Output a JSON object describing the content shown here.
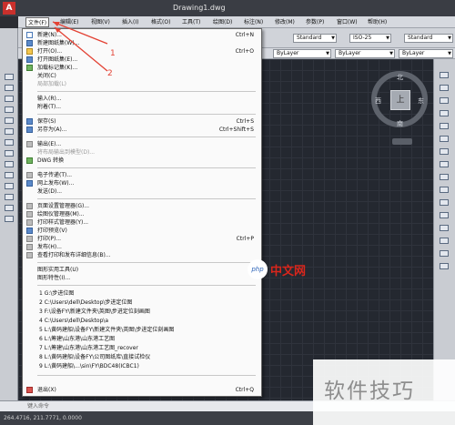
{
  "window": {
    "title": "Drawing1.dwg",
    "app_logo": "A"
  },
  "menubar": {
    "items": [
      "文件(F)",
      "编辑(E)",
      "视图(V)",
      "插入(I)",
      "格式(O)",
      "工具(T)",
      "绘图(D)",
      "标注(N)",
      "修改(M)",
      "参数(P)",
      "窗口(W)",
      "帮助(H)"
    ]
  },
  "toolbar": {
    "style_combo": "Standard",
    "dim_combo": "ISO-25",
    "table_combo": "Standard",
    "layer_combo": "ByLayer",
    "linetype_combo": "ByLayer",
    "lineweight_combo": "ByLayer"
  },
  "viewcube": {
    "face": "上",
    "north": "北",
    "south": "南",
    "east": "东",
    "west": "西"
  },
  "file_menu": {
    "items": [
      {
        "label": "新建(N)...",
        "shortcut": "Ctrl+N",
        "icon": "new-doc-icon",
        "state": "normal"
      },
      {
        "label": "新建图纸集(W)...",
        "shortcut": "",
        "icon": "sheetset-icon",
        "state": "normal"
      },
      {
        "label": "打开(O)...",
        "shortcut": "Ctrl+O",
        "icon": "open-folder-icon",
        "state": "normal"
      },
      {
        "label": "打开图纸集(E)...",
        "shortcut": "",
        "icon": "open-sheetset-icon",
        "state": "normal"
      },
      {
        "label": "加载标记集(K)...",
        "shortcut": "",
        "icon": "markup-icon",
        "state": "normal"
      },
      {
        "label": "关闭(C)",
        "shortcut": "",
        "icon": "",
        "state": "normal"
      },
      {
        "label": "局部加载(L)",
        "shortcut": "",
        "icon": "",
        "state": "disabled"
      },
      {
        "label": "输入(R)...",
        "shortcut": "",
        "icon": "",
        "state": "normal"
      },
      {
        "label": "附着(T)...",
        "shortcut": "",
        "icon": "",
        "state": "normal"
      },
      {
        "label": "保存(S)",
        "shortcut": "Ctrl+S",
        "icon": "save-icon",
        "state": "normal"
      },
      {
        "label": "另存为(A)...",
        "shortcut": "Ctrl+Shift+S",
        "icon": "save-as-icon",
        "state": "normal"
      },
      {
        "label": "输出(E)...",
        "shortcut": "",
        "icon": "export-icon",
        "state": "normal"
      },
      {
        "label": "将布局输出到模型(D)...",
        "shortcut": "",
        "icon": "",
        "state": "disabled"
      },
      {
        "label": "DWG 转换",
        "shortcut": "",
        "icon": "dwg-convert-icon",
        "state": "normal"
      },
      {
        "label": "电子传递(T)...",
        "shortcut": "",
        "icon": "etransmit-icon",
        "state": "normal"
      },
      {
        "label": "网上发布(W)...",
        "shortcut": "",
        "icon": "publish-web-icon",
        "state": "normal"
      },
      {
        "label": "发送(D)...",
        "shortcut": "",
        "icon": "",
        "state": "normal"
      },
      {
        "label": "页面设置管理器(G)...",
        "shortcut": "",
        "icon": "page-setup-icon",
        "state": "normal"
      },
      {
        "label": "绘图仪管理器(M)...",
        "shortcut": "",
        "icon": "plotter-icon",
        "state": "normal"
      },
      {
        "label": "打印样式管理器(Y)...",
        "shortcut": "",
        "icon": "plot-style-icon",
        "state": "normal"
      },
      {
        "label": "打印预览(V)",
        "shortcut": "",
        "icon": "preview-icon",
        "state": "normal"
      },
      {
        "label": "打印(P)...",
        "shortcut": "Ctrl+P",
        "icon": "print-icon",
        "state": "normal"
      },
      {
        "label": "发布(H)...",
        "shortcut": "",
        "icon": "publish-icon",
        "state": "normal"
      },
      {
        "label": "查看打印和发布详细信息(B)...",
        "shortcut": "",
        "icon": "plot-details-icon",
        "state": "normal"
      },
      {
        "label": "图形实用工具(U)",
        "shortcut": "",
        "icon": "",
        "state": "submenu"
      },
      {
        "label": "图形特性(I)...",
        "shortcut": "",
        "icon": "",
        "state": "normal"
      },
      {
        "label": "1 G:\\步进位图",
        "shortcut": "",
        "icon": "",
        "state": "recent"
      },
      {
        "label": "2 C:\\Users\\dell\\Desktop\\步进定位图",
        "shortcut": "",
        "icon": "",
        "state": "recent"
      },
      {
        "label": "3 F:\\设备FY\\新建文件夹\\英图\\步进定位刻画图",
        "shortcut": "",
        "icon": "",
        "state": "recent"
      },
      {
        "label": "4 C:\\Users\\dell\\Desktop\\a",
        "shortcut": "",
        "icon": "",
        "state": "recent"
      },
      {
        "label": "5 L:\\黄码建船\\设备FY\\新建文件夹\\英图\\步进定位刻画图",
        "shortcut": "",
        "icon": "",
        "state": "recent"
      },
      {
        "label": "6 L:\\筹建\\山东港\\山东港工艺图",
        "shortcut": "",
        "icon": "",
        "state": "recent"
      },
      {
        "label": "7 L:\\筹建\\山东港\\山东港工艺图_recover",
        "shortcut": "",
        "icon": "",
        "state": "recent"
      },
      {
        "label": "8 L:\\黄码建船\\设备FY\\公司图纸库\\直接试检仪",
        "shortcut": "",
        "icon": "",
        "state": "recent"
      },
      {
        "label": "9 L:\\黄码建船\\...\\sin\\FY\\BDC48(ICBC1)",
        "shortcut": "",
        "icon": "",
        "state": "recent"
      },
      {
        "label": "退出(X)",
        "shortcut": "Ctrl+Q",
        "icon": "exit-icon",
        "state": "normal"
      }
    ]
  },
  "annotations": {
    "step1": "1",
    "step2": "2"
  },
  "command_line": {
    "placeholder": "键入命令"
  },
  "status_bar": {
    "coords": "264.4716, 211.7771, 0.0000"
  },
  "watermarks": {
    "logo": "php",
    "site": "中文网",
    "corner": "软件技巧"
  },
  "colors": {
    "accent_red": "#e34234",
    "canvas": "#242830",
    "menu_highlight": "#cfe3f7"
  }
}
